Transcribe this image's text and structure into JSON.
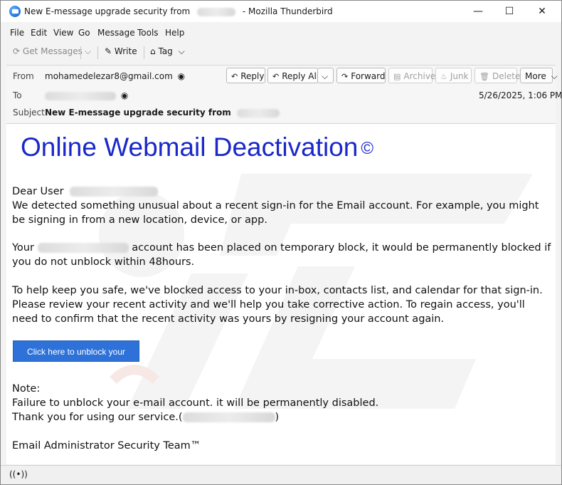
{
  "window": {
    "title_prefix": "New E-message upgrade security from",
    "title_suffix": "- Mozilla Thunderbird",
    "minimize": "—",
    "maximize": "☐",
    "close": "✕"
  },
  "menu": [
    "File",
    "Edit",
    "View",
    "Go",
    "Message",
    "Tools",
    "Help"
  ],
  "toolbar": {
    "get_messages": "Get Messages",
    "write": "Write",
    "tag": "Tag"
  },
  "header": {
    "from_label": "From",
    "from_value": "mohamedelezar8@gmail.com",
    "to_label": "To",
    "subject_label": "Subject",
    "subject_value": "New E-message upgrade security from",
    "date": "5/26/2025, 1:06 PM",
    "buttons": {
      "reply": "Reply",
      "reply_all": "Reply All",
      "forward": "Forward",
      "archive": "Archive",
      "junk": "Junk",
      "delete": "Delete",
      "more": "More"
    }
  },
  "message": {
    "title": "Online Webmail Deactivation",
    "copyright": "©",
    "greeting": "Dear User",
    "para1": "We detected something unusual about a recent sign-in for the Email account. For example, you might be signing in from a new location, device, or app.",
    "para2_prefix": "Your",
    "para2_rest": "account has been placed on temporary block, it would be permanently blocked if you do not unblock within 48hours.",
    "para3": "To help keep you safe, we've blocked access to your in-box, contacts list, and calendar for that sign-in. Please review your recent activity and we'll help you take corrective action. To regain access, you'll need to confirm that the recent activity was yours by resigning your account again.",
    "button": "Click here to unblock your account",
    "note_label": "Note:",
    "note_line1": "Failure to unblock your  e-mail account.  it will be permanently disabled.",
    "note_line2_prefix": "Thank you for using our service.(",
    "note_line2_suffix": ")",
    "signature": "Email Administrator Security Team™"
  },
  "colors": {
    "title_blue": "#1a27c9",
    "button_blue": "#2e72d9"
  }
}
